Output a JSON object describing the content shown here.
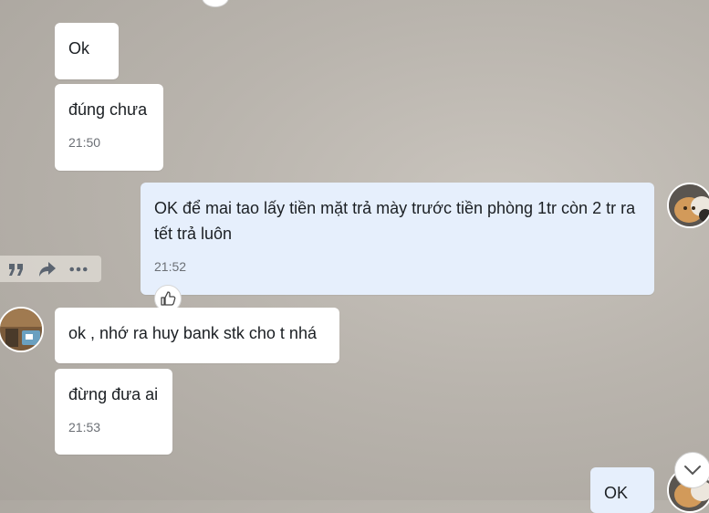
{
  "messages": [
    {
      "text": "Ok",
      "time": ""
    },
    {
      "text": "đúng chưa",
      "time": "21:50"
    },
    {
      "text": "OK để mai tao lấy tiền mặt trả mày trước tiền phòng 1tr còn 2 tr ra tết trả luôn",
      "time": "21:52"
    },
    {
      "text": "ok , nhớ ra huy bank stk cho t nhá",
      "time": ""
    },
    {
      "text": "đừng đưa ai",
      "time": "21:53"
    },
    {
      "text": "OK",
      "time": ""
    }
  ],
  "message_actions": [
    "quote-icon",
    "share-icon",
    "more-icon"
  ],
  "icons": {
    "like": "thumbs-up-icon",
    "scroll": "chevron-down-icon"
  },
  "colors": {
    "incoming_bubble": "#ffffff",
    "outgoing_bubble": "#e6effc",
    "time": "#6b6f75"
  }
}
